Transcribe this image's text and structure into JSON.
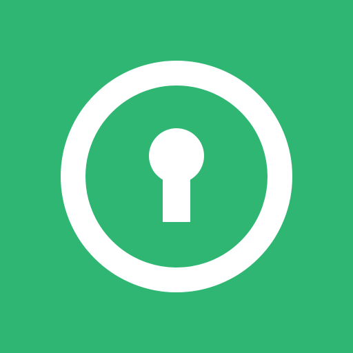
{
  "app_icon": {
    "icon": "keyhole-lock-icon",
    "colors": {
      "background": "#2FB673",
      "foreground": "#FFFFFF"
    }
  }
}
